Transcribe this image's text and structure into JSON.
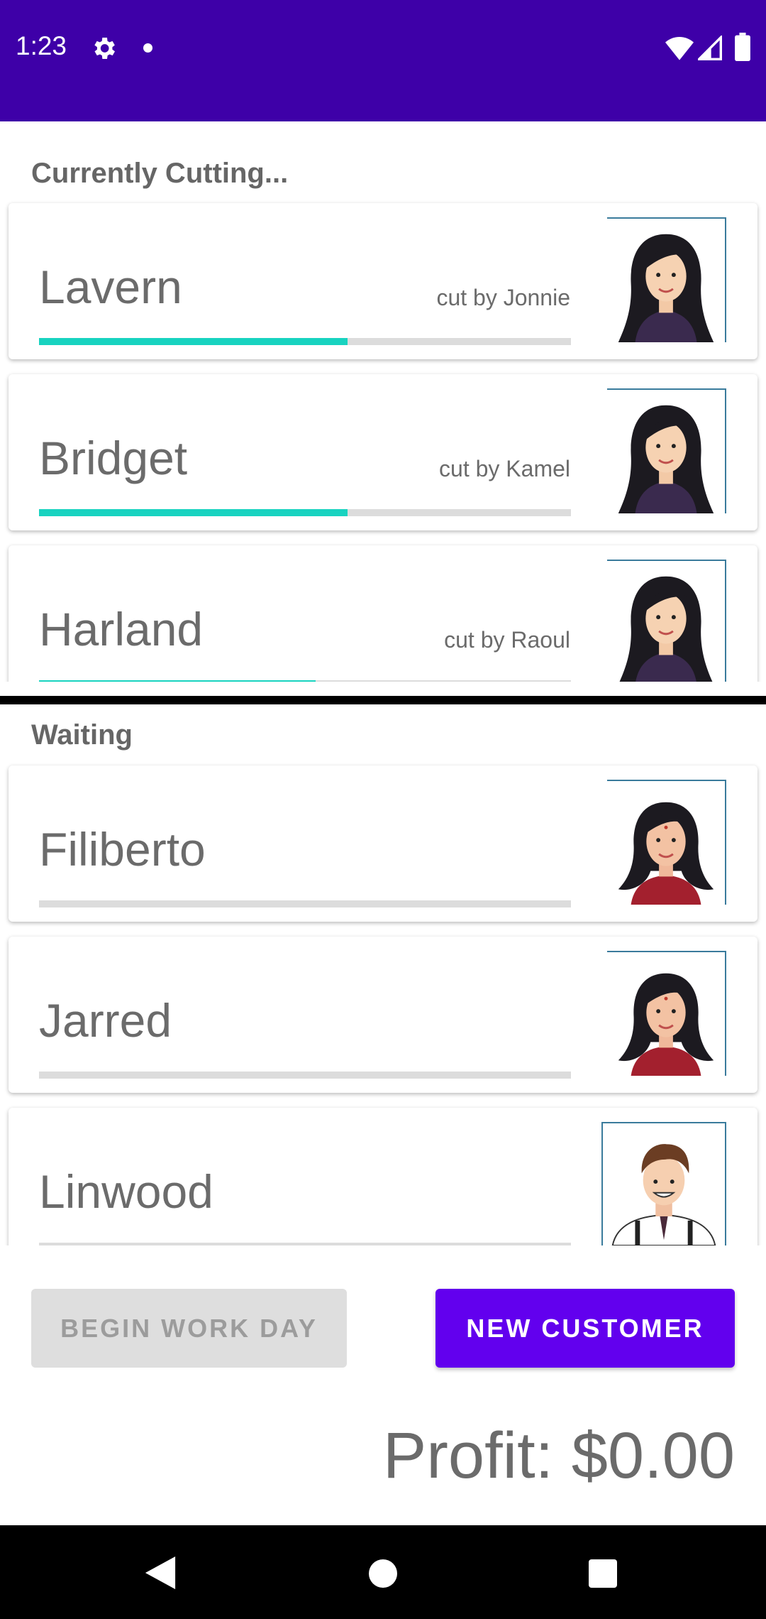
{
  "status_bar": {
    "time": "1:23",
    "icons": [
      "gear-icon",
      "notification-dot-icon",
      "wifi-icon",
      "signal-icon",
      "battery-icon"
    ]
  },
  "currently_cutting": {
    "title": "Currently Cutting...",
    "items": [
      {
        "name": "Lavern",
        "subtitle": "cut by Jonnie",
        "progress": 0.58,
        "avatar": "woman-long-hair-avatar"
      },
      {
        "name": "Bridget",
        "subtitle": "cut by Kamel",
        "progress": 0.58,
        "avatar": "woman-long-hair-avatar"
      },
      {
        "name": "Harland",
        "subtitle": "cut by Raoul",
        "progress": 0.52,
        "avatar": "woman-long-hair-avatar"
      }
    ]
  },
  "waiting": {
    "title": "Waiting",
    "items": [
      {
        "name": "Filiberto",
        "progress": 0,
        "avatar": "woman-red-shirt-avatar"
      },
      {
        "name": "Jarred",
        "progress": 0,
        "avatar": "woman-red-shirt-avatar"
      },
      {
        "name": "Linwood",
        "progress": 0,
        "avatar": "man-suspenders-avatar"
      }
    ]
  },
  "buttons": {
    "begin_work_day": "BEGIN WORK DAY",
    "new_customer": "NEW CUSTOMER"
  },
  "profit": "Profit: $0.00",
  "colors": {
    "status_bar": "#3e00a8",
    "primary": "#6200ee",
    "progress": "#18d3c0",
    "track": "#dcdcdc"
  }
}
